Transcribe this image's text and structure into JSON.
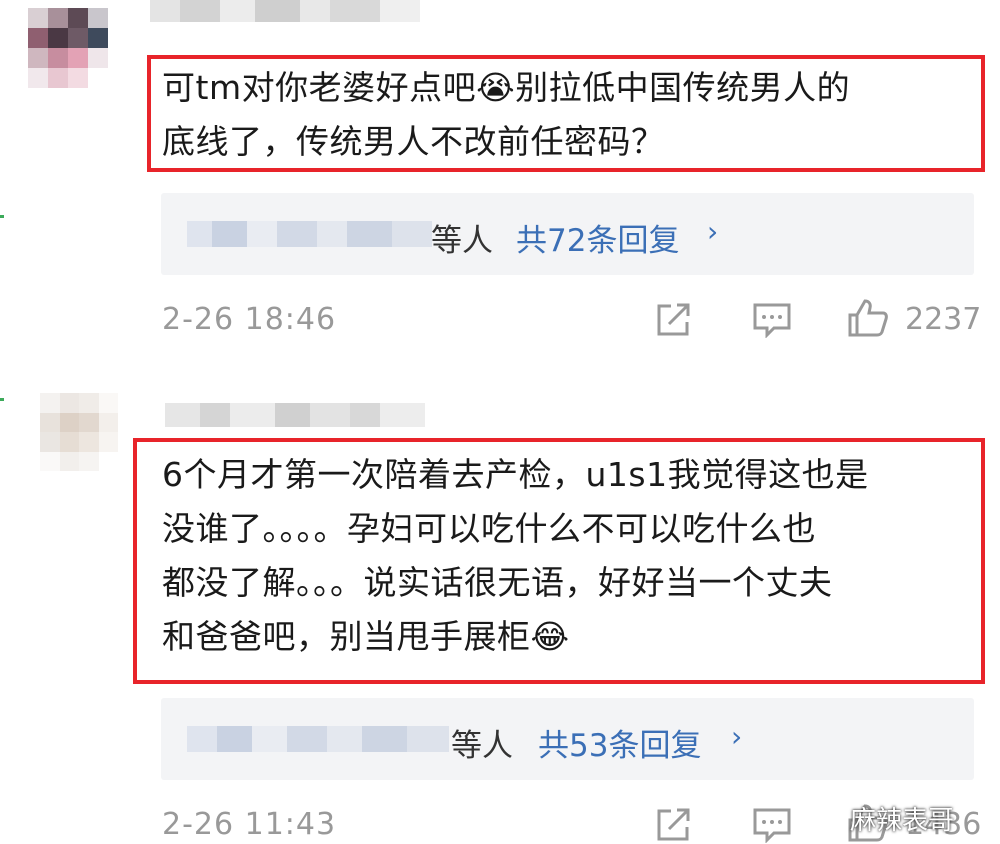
{
  "comments": [
    {
      "text_line1": "可tm对你老婆好点吧😭别拉低中国传统男人的",
      "text_line2": "底线了，传统男人不改前任密码？",
      "reply_etc": "等人",
      "reply_count": "共72条回复",
      "reply_chevron": "›",
      "timestamp": "2-26 18:46",
      "likes": "2237"
    },
    {
      "text_line1": "6个月才第一次陪着去产检，u1s1我觉得这也是",
      "text_line2": "没谁了。。。。孕妇可以吃什么不可以吃什么也",
      "text_line3": "都没了解。。。说实话很无语，好好当一个丈夫",
      "text_line4": "和爸爸吧，别当甩手展柜😂",
      "reply_etc": "等人",
      "reply_count": "共53条回复",
      "reply_chevron": "›",
      "timestamp": "2-26 11:43",
      "likes": "1436"
    }
  ],
  "watermark": {
    "text": "麻辣表哥"
  },
  "icons": [
    "share-icon",
    "comment-icon",
    "like-icon",
    "wechat-icon"
  ],
  "colors": {
    "highlight": "#e8242a",
    "link": "#3b6fb6",
    "meta": "#999999",
    "reply_bg": "#f3f4f6"
  }
}
